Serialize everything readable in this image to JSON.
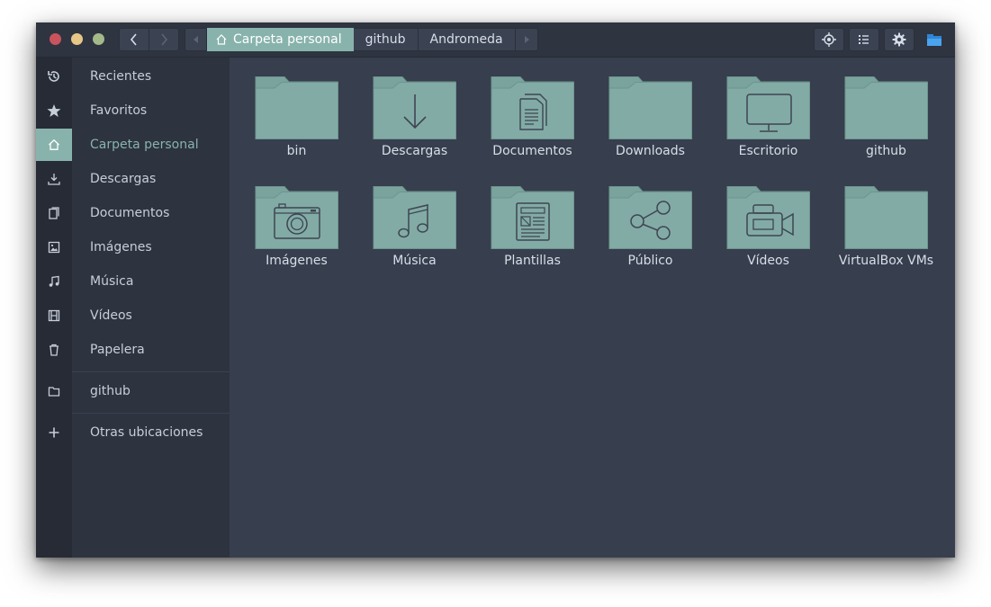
{
  "window": {
    "controls": [
      "close",
      "minimize",
      "maximize"
    ]
  },
  "header": {
    "nav": {
      "back_icon": "chevron-left-icon",
      "forward_icon": "chevron-right-icon"
    },
    "path": [
      {
        "label": "Carpeta personal",
        "icon": "home-icon",
        "active": true
      },
      {
        "label": "github",
        "active": false
      },
      {
        "label": "Andromeda",
        "active": false
      }
    ],
    "tools": [
      "locate-icon",
      "list-view-icon",
      "gear-icon",
      "folder-app-icon"
    ]
  },
  "sidebar": {
    "items": [
      {
        "label": "Recientes",
        "icon": "history-icon"
      },
      {
        "label": "Favoritos",
        "icon": "star-icon"
      },
      {
        "label": "Carpeta personal",
        "icon": "home-icon",
        "active": true
      },
      {
        "label": "Descargas",
        "icon": "download-icon"
      },
      {
        "label": "Documentos",
        "icon": "document-icon"
      },
      {
        "label": "Imágenes",
        "icon": "image-icon"
      },
      {
        "label": "Música",
        "icon": "music-icon"
      },
      {
        "label": "Vídeos",
        "icon": "film-icon"
      },
      {
        "label": "Papelera",
        "icon": "trash-icon"
      }
    ],
    "bookmarks": [
      {
        "label": "github",
        "icon": "folder-icon"
      }
    ],
    "other": {
      "label": "Otras ubicaciones",
      "icon": "plus-icon"
    }
  },
  "files": [
    {
      "name": "bin",
      "glyph": "none"
    },
    {
      "name": "Descargas",
      "glyph": "download"
    },
    {
      "name": "Documentos",
      "glyph": "document"
    },
    {
      "name": "Downloads",
      "glyph": "none"
    },
    {
      "name": "Escritorio",
      "glyph": "monitor"
    },
    {
      "name": "github",
      "glyph": "none"
    },
    {
      "name": "Imágenes",
      "glyph": "camera"
    },
    {
      "name": "Música",
      "glyph": "music"
    },
    {
      "name": "Plantillas",
      "glyph": "template"
    },
    {
      "name": "Público",
      "glyph": "share"
    },
    {
      "name": "Vídeos",
      "glyph": "video"
    },
    {
      "name": "VirtualBox VMs",
      "glyph": "none"
    }
  ],
  "colors": {
    "accent": "#88b3ac",
    "folder_fill": "#82aba5",
    "folder_tab": "#7aa39d",
    "glyph": "#3e4552",
    "content_bg": "#373e4d",
    "sidebar_bg": "#2d333f"
  }
}
